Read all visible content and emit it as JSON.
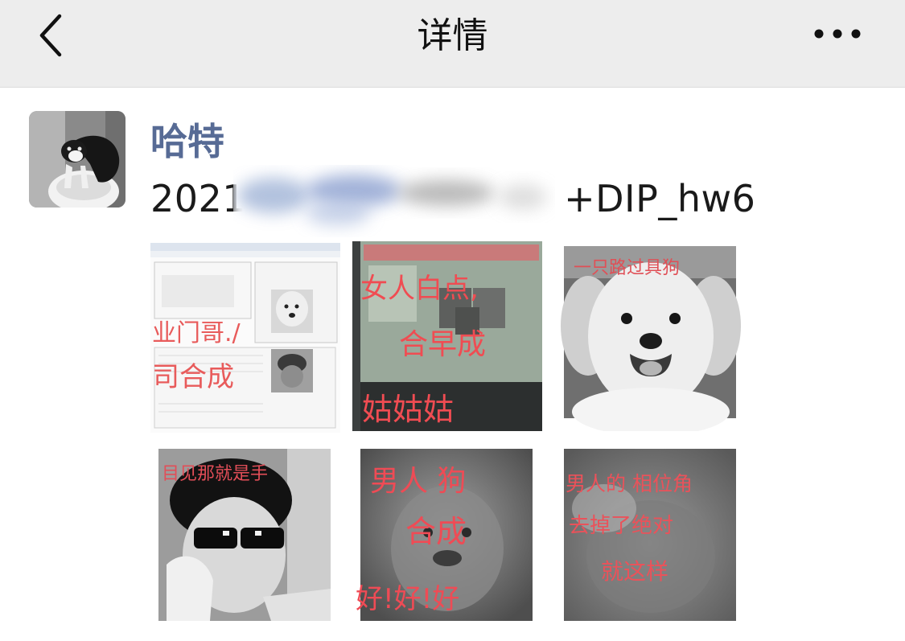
{
  "header": {
    "title": "详情",
    "back_icon": "chevron-left-icon",
    "more_icon": "more-horizontal-icon",
    "background": "#ededed"
  },
  "post": {
    "username": "哈特",
    "username_color": "#576b95",
    "text_prefix": "2021",
    "text_suffix": "+DIP_hw6",
    "images": [
      {
        "id": "image-1",
        "annotations": [
          "业门哥./",
          "司合成"
        ]
      },
      {
        "id": "image-2",
        "annotations": [
          "女人白点,",
          "合早成",
          "姑姑姑"
        ]
      },
      {
        "id": "image-3",
        "annotations": [
          "一只路过具狗"
        ]
      },
      {
        "id": "image-4",
        "annotations": [
          "目见那就是手"
        ]
      },
      {
        "id": "image-5",
        "annotations": [
          "男人 狗",
          "合成",
          "好!好!好"
        ]
      },
      {
        "id": "image-6",
        "annotations": [
          "男人的 相位角",
          "去掉了绝对",
          "就这样"
        ]
      }
    ]
  }
}
